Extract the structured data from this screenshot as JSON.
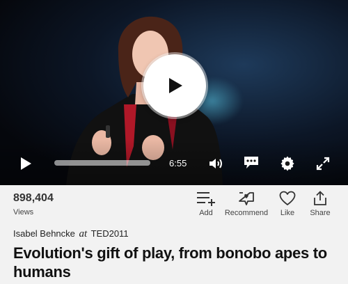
{
  "player": {
    "current_time": "6:55",
    "progress_fraction": 0.0
  },
  "stats": {
    "views_count": "898,404",
    "views_label": "Views"
  },
  "actions": {
    "add": "Add",
    "recommend": "Recommend",
    "like": "Like",
    "share": "Share"
  },
  "talk": {
    "speaker": "Isabel Behncke",
    "at_word": "at",
    "event": "TED2011",
    "title": "Evolution's gift of play, from bonobo apes to humans"
  },
  "colors": {
    "accent": "#ffffff",
    "background": "#f2f2f2",
    "icon": "#333333"
  }
}
